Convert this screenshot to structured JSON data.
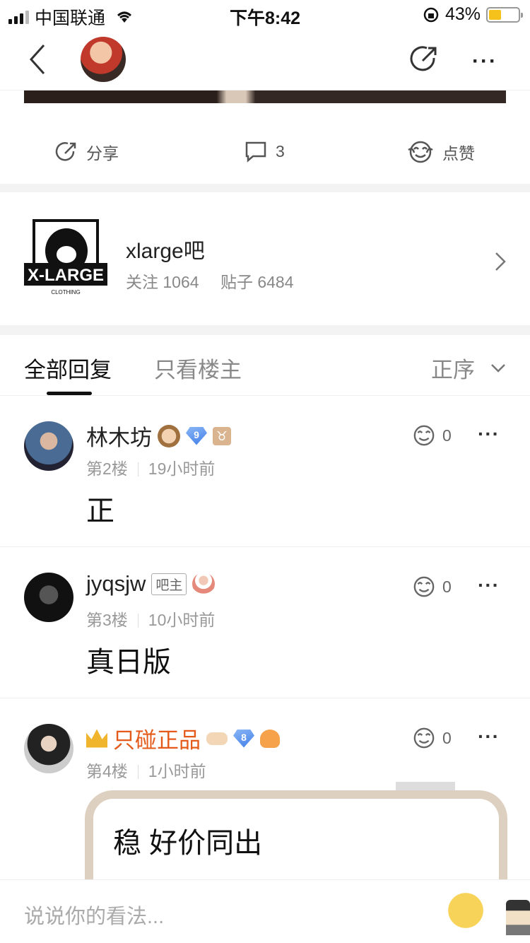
{
  "status_bar": {
    "carrier": "中国联通",
    "time": "下午8:42",
    "battery": "43%"
  },
  "nav": {
    "share_icon": "share-icon",
    "more": "···"
  },
  "actions": {
    "share_label": "分享",
    "comment_count": "3",
    "like_label": "点赞"
  },
  "forum": {
    "name": "xlarge吧",
    "follow": "关注 1064",
    "posts": "贴子 6484",
    "logo_text": "X-LARGE",
    "logo_sub": "CLOTHING"
  },
  "tabs": {
    "all": "全部回复",
    "owner_only": "只看楼主",
    "sort": "正序"
  },
  "replies": [
    {
      "name": "林木坊",
      "level": "9",
      "zodiac": "♉",
      "floor": "第2楼",
      "time": "19小时前",
      "likes": "0",
      "body": "正"
    },
    {
      "name": "jyqsjw",
      "tag": "吧主",
      "floor": "第3楼",
      "time": "10小时前",
      "likes": "0",
      "body": "真日版"
    },
    {
      "name": "只碰正品",
      "level": "8",
      "floor": "第4楼",
      "time": "1小时前",
      "likes": "0",
      "body": "稳 好价同出"
    }
  ],
  "input": {
    "placeholder": "说说你的看法..."
  },
  "colors": {
    "gold_name": "#e35a1a",
    "battery": "#f5c21b"
  }
}
